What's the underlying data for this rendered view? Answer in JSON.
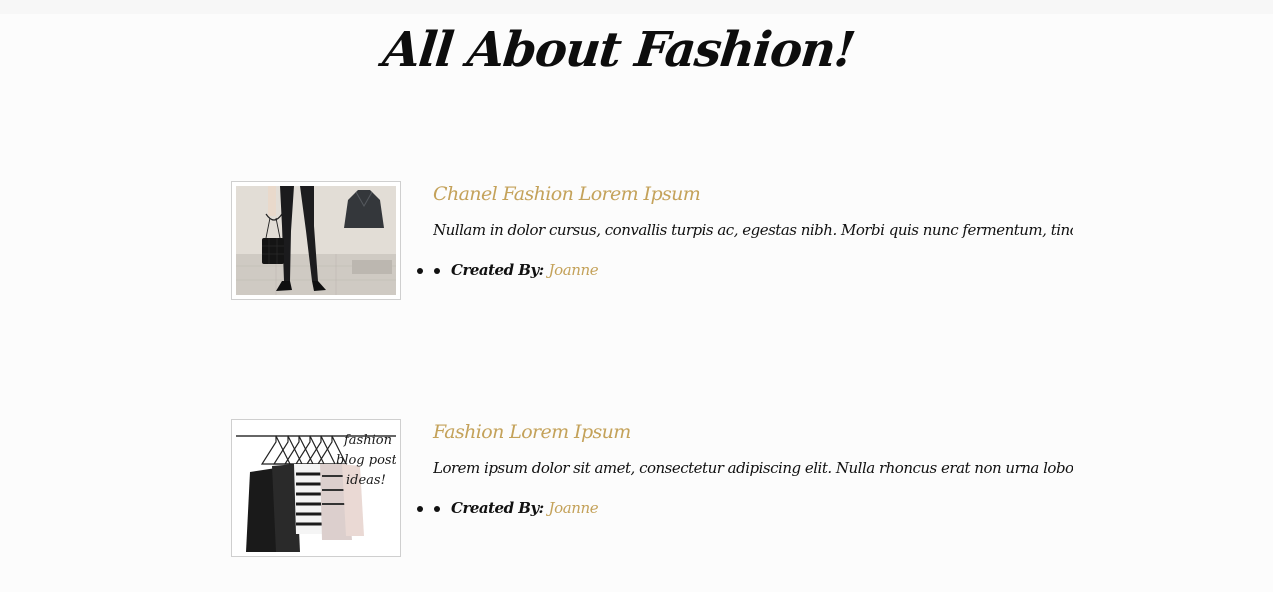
{
  "site": {
    "title": "All About Fashion!"
  },
  "posts": [
    {
      "title": "Chanel Fashion Lorem Ipsum",
      "excerpt": "Nullam in dolor cursus, convallis turpis ac, egestas nibh. Morbi quis nunc fermentum, tincidunt r...",
      "created_by_label": "Created By:",
      "author": "Joanne",
      "image_icon": "legs-handbag-photo"
    },
    {
      "title": "Fashion Lorem Ipsum",
      "excerpt": "Lorem ipsum dolor sit amet, consectetur adipiscing elit. Nulla rhoncus erat non urna lobortis, au...",
      "created_by_label": "Created By:",
      "author": "Joanne",
      "image_icon": "clothes-rack-photo",
      "image_caption": [
        "fashion",
        "blog post",
        "ideas!"
      ]
    }
  ],
  "colors": {
    "accent": "#c4a25a",
    "text": "#111111",
    "background": "#fcfcfc"
  }
}
